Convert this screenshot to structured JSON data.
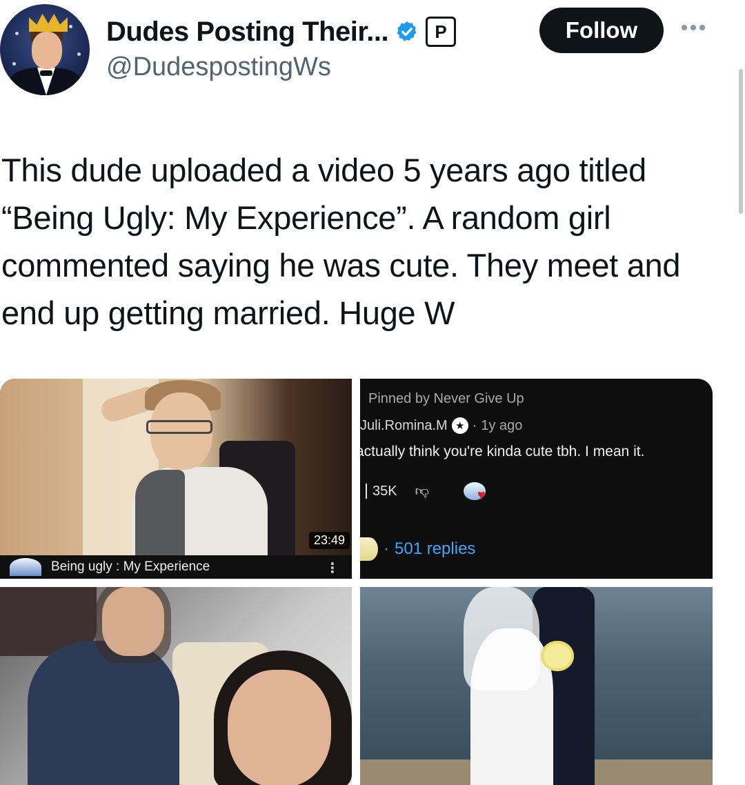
{
  "account": {
    "display_name": "Dudes Posting Their...",
    "handle": "@DudespostingWs",
    "badge_letter": "P",
    "follow_label": "Follow"
  },
  "tweet": {
    "text": "This dude uploaded a video 5 years ago titled “Being Ugly: My Experience”. A random girl commented saying he was cute. They meet and end up getting married. Huge W"
  },
  "media": {
    "video": {
      "duration": "23:49",
      "title": "Being ugly : My Experience"
    },
    "comment": {
      "pinned_by": "Pinned by Never Give Up",
      "author": "Juli.Romina.M",
      "age": "1y ago",
      "separator": "·",
      "text": "actually think you're kinda cute tbh. I mean it.",
      "likes": "35K",
      "replies": "501 replies"
    }
  },
  "colors": {
    "follow_bg": "#0f1419",
    "verified_blue": "#1d9bf0",
    "reply_link": "#3ea6ff"
  }
}
